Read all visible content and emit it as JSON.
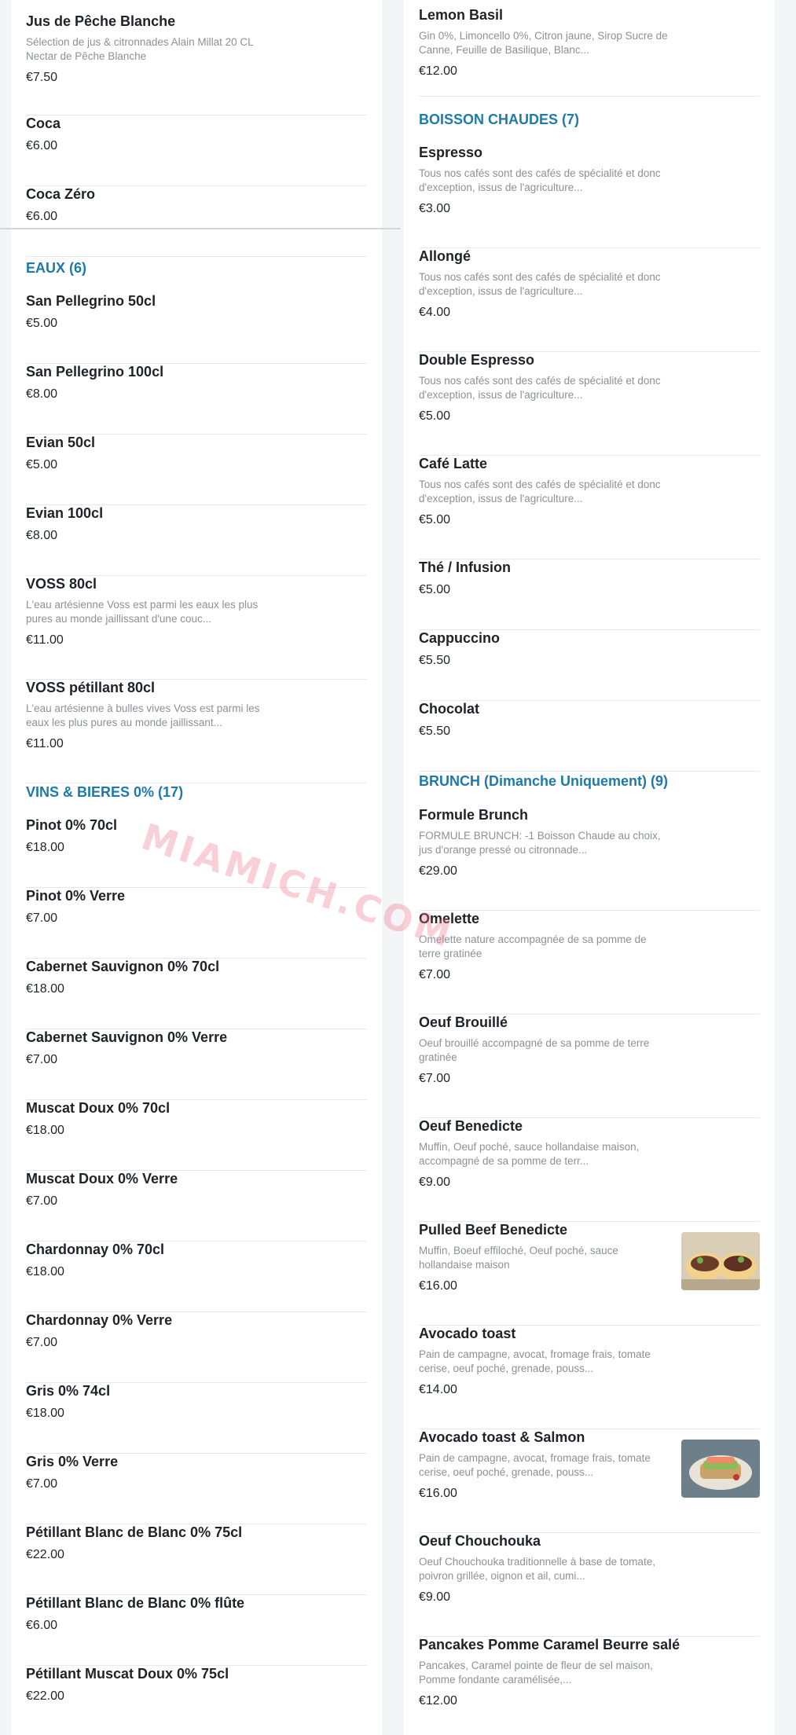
{
  "left": {
    "top_items": [
      {
        "name": "Jus de Pêche Blanche",
        "desc": "Sélection de jus & citronnades Alain Millat 20 CL Nectar de Pêche Blanche",
        "price": "€7.50"
      },
      {
        "name": "Coca",
        "desc": "",
        "price": "€6.00"
      },
      {
        "name": "Coca Zéro",
        "desc": "",
        "price": "€6.00"
      }
    ],
    "eaux": {
      "header": "EAUX (6)",
      "items": [
        {
          "name": "San Pellegrino 50cl",
          "desc": "",
          "price": "€5.00"
        },
        {
          "name": "San Pellegrino 100cl",
          "desc": "",
          "price": "€8.00"
        },
        {
          "name": "Evian 50cl",
          "desc": "",
          "price": "€5.00"
        },
        {
          "name": "Evian 100cl",
          "desc": "",
          "price": "€8.00"
        },
        {
          "name": "VOSS 80cl",
          "desc": "L'eau artésienne Voss est parmi les eaux les plus pures au monde jaillissant d'une couc...",
          "price": "€11.00"
        },
        {
          "name": "VOSS pétillant 80cl",
          "desc": "L'eau artésienne à bulles vives Voss est parmi les eaux les plus pures au monde jaillissant...",
          "price": "€11.00"
        }
      ]
    },
    "vins": {
      "header": "VINS & BIERES 0% (17)",
      "items": [
        {
          "name": "Pinot 0% 70cl",
          "desc": "",
          "price": "€18.00"
        },
        {
          "name": "Pinot 0% Verre",
          "desc": "",
          "price": "€7.00"
        },
        {
          "name": "Cabernet Sauvignon 0% 70cl",
          "desc": "",
          "price": "€18.00"
        },
        {
          "name": "Cabernet Sauvignon 0% Verre",
          "desc": "",
          "price": "€7.00"
        },
        {
          "name": "Muscat Doux 0% 70cl",
          "desc": "",
          "price": "€18.00"
        },
        {
          "name": "Muscat Doux 0% Verre",
          "desc": "",
          "price": "€7.00"
        },
        {
          "name": "Chardonnay 0% 70cl",
          "desc": "",
          "price": "€18.00"
        },
        {
          "name": "Chardonnay 0% Verre",
          "desc": "",
          "price": "€7.00"
        },
        {
          "name": "Gris 0% 74cl",
          "desc": "",
          "price": "€18.00"
        },
        {
          "name": "Gris 0% Verre",
          "desc": "",
          "price": "€7.00"
        },
        {
          "name": "Pétillant Blanc de Blanc 0% 75cl",
          "desc": "",
          "price": "€22.00"
        },
        {
          "name": "Pétillant Blanc de Blanc 0% flûte",
          "desc": "",
          "price": "€6.00"
        },
        {
          "name": "Pétillant Muscat Doux 0% 75cl",
          "desc": "",
          "price": "€22.00"
        }
      ]
    }
  },
  "right": {
    "top_items": [
      {
        "name": "Lemon Basil",
        "desc": "Gin 0%, Limoncello 0%, Citron jaune, Sirop Sucre de Canne, Feuille de Basilique, Blanc...",
        "price": "€12.00"
      }
    ],
    "boissons": {
      "header": "BOISSON CHAUDES (7)",
      "items": [
        {
          "name": "Espresso",
          "desc": "Tous nos cafés sont des cafés de spécialité et donc d'exception, issus de l'agriculture...",
          "price": "€3.00"
        },
        {
          "name": "Allongé",
          "desc": "Tous nos cafés sont des cafés de spécialité et donc d'exception, issus de l'agriculture...",
          "price": "€4.00"
        },
        {
          "name": "Double Espresso",
          "desc": "Tous nos cafés sont des cafés de spécialité et donc d'exception, issus de l'agriculture...",
          "price": "€5.00"
        },
        {
          "name": "Café Latte",
          "desc": "Tous nos cafés sont des cafés de spécialité et donc d'exception, issus de l'agriculture...",
          "price": "€5.00"
        },
        {
          "name": "Thé / Infusion",
          "desc": "",
          "price": "€5.00"
        },
        {
          "name": "Cappuccino",
          "desc": "",
          "price": "€5.50"
        },
        {
          "name": "Chocolat",
          "desc": "",
          "price": "€5.50"
        }
      ]
    },
    "brunch": {
      "header": "BRUNCH (Dimanche Uniquement) (9)",
      "items": [
        {
          "name": "Formule Brunch",
          "desc": "FORMULE BRUNCH: -1 Boisson Chaude au choix, jus d'orange pressé ou citronnade...",
          "price": "€29.00"
        },
        {
          "name": "Omelette",
          "desc": "Omelette nature accompagnée de sa pomme de terre gratinée",
          "price": "€7.00"
        },
        {
          "name": "Oeuf Brouillé",
          "desc": "Oeuf brouillé accompagné de sa pomme de terre gratinée",
          "price": "€7.00"
        },
        {
          "name": "Oeuf Benedicte",
          "desc": "Muffin, Oeuf poché, sauce hollandaise maison, accompagné de sa pomme de terr...",
          "price": "€9.00"
        },
        {
          "name": "Pulled Beef Benedicte",
          "desc": "Muffin, Boeuf effiloché, Oeuf poché, sauce hollandaise maison",
          "price": "€16.00"
        },
        {
          "name": "Avocado toast",
          "desc": "Pain de campagne, avocat, fromage frais, tomate cerise, oeuf poché, grenade, pouss...",
          "price": "€14.00"
        },
        {
          "name": "Avocado toast & Salmon",
          "desc": "Pain de campagne, avocat, fromage frais, tomate cerise, oeuf poché, grenade, pouss...",
          "price": "€16.00"
        },
        {
          "name": "Oeuf Chouchouka",
          "desc": "Oeuf Chouchouka traditionnelle à base de tomate, poivron grillée, oignon et ail, cumi...",
          "price": "€9.00"
        },
        {
          "name": "Pancakes Pomme Caramel Beurre salé",
          "desc": "Pancakes, Caramel pointe de fleur de sel maison, Pomme fondante caramélisée,...",
          "price": "€12.00"
        }
      ]
    }
  },
  "watermark": "MIAMICH.COM"
}
